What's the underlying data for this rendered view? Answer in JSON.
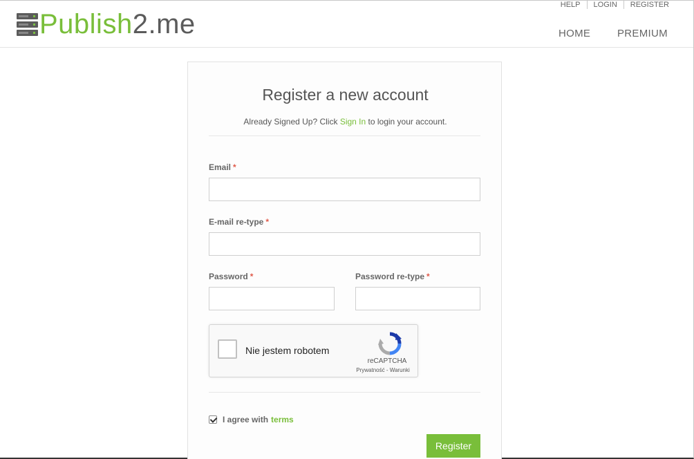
{
  "header": {
    "logo_primary": "Publish",
    "logo_secondary": "2.me",
    "top_links": [
      "HELP",
      "LOGIN",
      "REGISTER"
    ],
    "nav": {
      "home": "HOME",
      "premium": "PREMIUM"
    }
  },
  "form": {
    "title": "Register a new account",
    "subtitle_before": "Already Signed Up? Click ",
    "subtitle_link": "Sign In",
    "subtitle_after": " to login your account.",
    "required_mark": "*",
    "email_label": "Email",
    "email_value": "",
    "email_retype_label": "E-mail re-type",
    "email_retype_value": "",
    "password_label": "Password",
    "password_value": "",
    "password_retype_label": "Password re-type",
    "password_retype_value": "",
    "agree_text": "I agree with",
    "agree_link": "terms",
    "agree_checked": true,
    "register_label": "Register"
  },
  "captcha": {
    "label": "Nie jestem robotem",
    "brand": "reCAPTCHA",
    "links": "Prywatność - Warunki",
    "icon": "recaptcha-logo"
  },
  "colors": {
    "accent": "#79be3a",
    "logo_dark": "#5b5b5b",
    "required": "#e05a4a"
  }
}
